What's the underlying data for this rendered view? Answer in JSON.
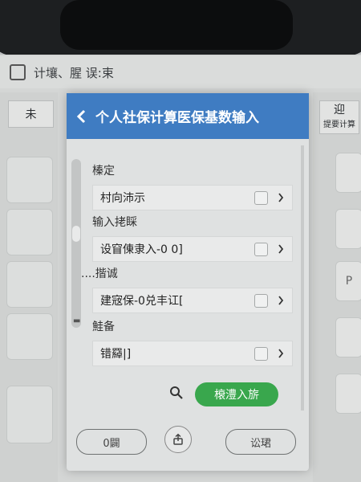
{
  "background": {
    "header_title": "计壤、腥 误:束",
    "left_tab": "未",
    "left_tiles": [
      "",
      "",
      "",
      "",
      "",
      "",
      "",
      ""
    ],
    "right_tab_line1": "迎",
    "right_tab_line2": "提要计算",
    "right_tile": "P"
  },
  "dialog": {
    "title": "个人社保计算医保基数输入",
    "sections": [
      {
        "label": "榛定",
        "value": "村向沛示"
      },
      {
        "label": "输入㧯睬",
        "value": "设窅倲隶入-0 0]"
      },
      {
        "label": "....揩诚",
        "value": "建宼保-0兑丰讧["
      },
      {
        "label": "鮭备",
        "value": "错羄|]"
      }
    ],
    "primary_button": "榱澧入旂",
    "footer_left": "0闢",
    "footer_right": "讼珺"
  },
  "colors": {
    "header_blue": "#3f7cc2",
    "primary_green": "#39a74d"
  },
  "icons": {
    "back": "chevron-left-icon",
    "search": "search-icon",
    "share": "share-icon",
    "chevron": "chevron-right-icon"
  }
}
